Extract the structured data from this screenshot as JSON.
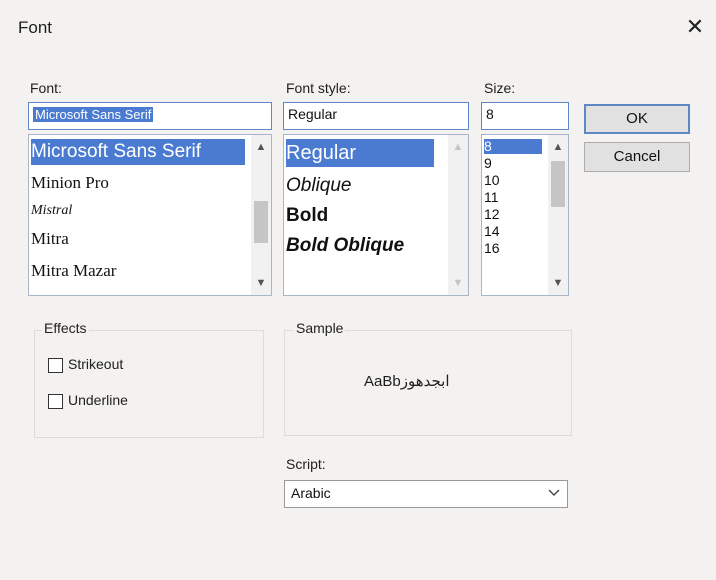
{
  "dialog": {
    "title": "Font",
    "close_symbol": "✕"
  },
  "font": {
    "label": "Font:",
    "value": "Microsoft Sans Serif",
    "items": [
      "Microsoft Sans Serif",
      "Minion Pro",
      "Mistral",
      "Mitra",
      "Mitra Mazar"
    ]
  },
  "style": {
    "label": "Font style:",
    "value": "Regular",
    "items": [
      "Regular",
      "Oblique",
      "Bold",
      "Bold Oblique"
    ]
  },
  "size": {
    "label": "Size:",
    "value": "8",
    "items": [
      "8",
      "9",
      "10",
      "11",
      "12",
      "14",
      "16"
    ]
  },
  "buttons": {
    "ok": "OK",
    "cancel": "Cancel"
  },
  "effects": {
    "label": "Effects",
    "strikeout": "Strikeout",
    "underline": "Underline"
  },
  "sample": {
    "label": "Sample",
    "text": "AaBbابجدهوز"
  },
  "script": {
    "label": "Script:",
    "value": "Arabic"
  },
  "icons": {
    "close": "close-icon",
    "scroll_up": "chevron-up-icon",
    "scroll_down": "chevron-down-icon",
    "dropdown": "chevron-down-icon"
  },
  "colors": {
    "selection": "#4a7bd1",
    "focus_border": "#5e87c4"
  }
}
